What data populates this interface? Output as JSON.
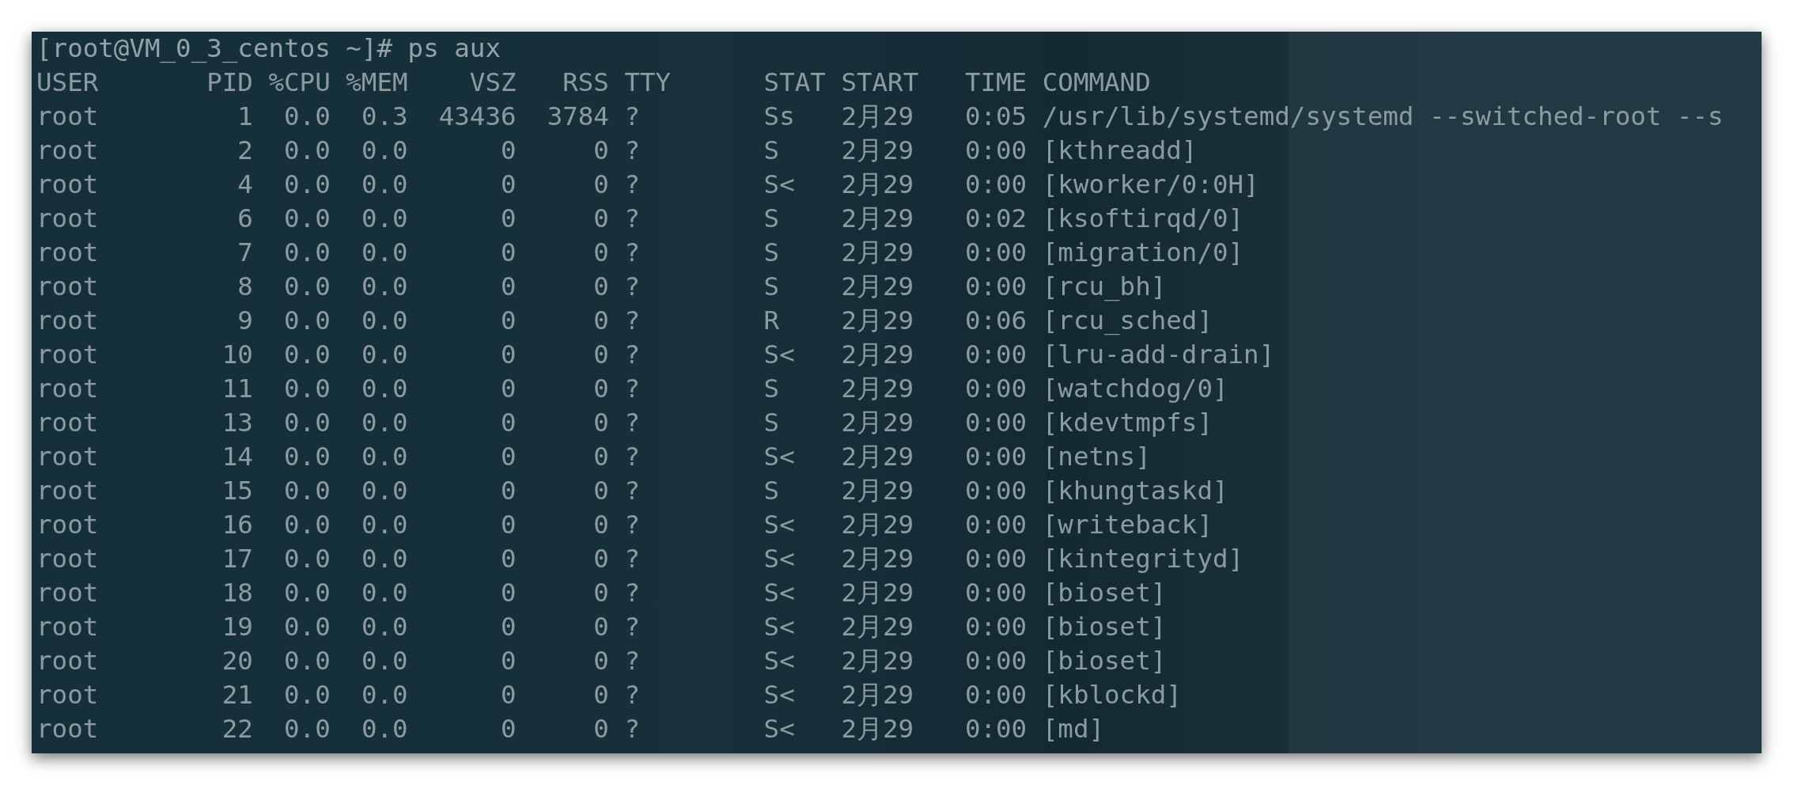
{
  "terminal": {
    "prompt": "[root@VM_0_3_centos ~]# ps aux",
    "columns": [
      "USER",
      "PID",
      "%CPU",
      "%MEM",
      "VSZ",
      "RSS",
      "TTY",
      "STAT",
      "START",
      "TIME",
      "COMMAND"
    ],
    "rows": [
      [
        "root",
        "1",
        "0.0",
        "0.3",
        "43436",
        "3784",
        "?",
        "Ss",
        "2月29",
        "0:05",
        "/usr/lib/systemd/systemd --switched-root --s"
      ],
      [
        "root",
        "2",
        "0.0",
        "0.0",
        "0",
        "0",
        "?",
        "S",
        "2月29",
        "0:00",
        "[kthreadd]"
      ],
      [
        "root",
        "4",
        "0.0",
        "0.0",
        "0",
        "0",
        "?",
        "S<",
        "2月29",
        "0:00",
        "[kworker/0:0H]"
      ],
      [
        "root",
        "6",
        "0.0",
        "0.0",
        "0",
        "0",
        "?",
        "S",
        "2月29",
        "0:02",
        "[ksoftirqd/0]"
      ],
      [
        "root",
        "7",
        "0.0",
        "0.0",
        "0",
        "0",
        "?",
        "S",
        "2月29",
        "0:00",
        "[migration/0]"
      ],
      [
        "root",
        "8",
        "0.0",
        "0.0",
        "0",
        "0",
        "?",
        "S",
        "2月29",
        "0:00",
        "[rcu_bh]"
      ],
      [
        "root",
        "9",
        "0.0",
        "0.0",
        "0",
        "0",
        "?",
        "R",
        "2月29",
        "0:06",
        "[rcu_sched]"
      ],
      [
        "root",
        "10",
        "0.0",
        "0.0",
        "0",
        "0",
        "?",
        "S<",
        "2月29",
        "0:00",
        "[lru-add-drain]"
      ],
      [
        "root",
        "11",
        "0.0",
        "0.0",
        "0",
        "0",
        "?",
        "S",
        "2月29",
        "0:00",
        "[watchdog/0]"
      ],
      [
        "root",
        "13",
        "0.0",
        "0.0",
        "0",
        "0",
        "?",
        "S",
        "2月29",
        "0:00",
        "[kdevtmpfs]"
      ],
      [
        "root",
        "14",
        "0.0",
        "0.0",
        "0",
        "0",
        "?",
        "S<",
        "2月29",
        "0:00",
        "[netns]"
      ],
      [
        "root",
        "15",
        "0.0",
        "0.0",
        "0",
        "0",
        "?",
        "S",
        "2月29",
        "0:00",
        "[khungtaskd]"
      ],
      [
        "root",
        "16",
        "0.0",
        "0.0",
        "0",
        "0",
        "?",
        "S<",
        "2月29",
        "0:00",
        "[writeback]"
      ],
      [
        "root",
        "17",
        "0.0",
        "0.0",
        "0",
        "0",
        "?",
        "S<",
        "2月29",
        "0:00",
        "[kintegrityd]"
      ],
      [
        "root",
        "18",
        "0.0",
        "0.0",
        "0",
        "0",
        "?",
        "S<",
        "2月29",
        "0:00",
        "[bioset]"
      ],
      [
        "root",
        "19",
        "0.0",
        "0.0",
        "0",
        "0",
        "?",
        "S<",
        "2月29",
        "0:00",
        "[bioset]"
      ],
      [
        "root",
        "20",
        "0.0",
        "0.0",
        "0",
        "0",
        "?",
        "S<",
        "2月29",
        "0:00",
        "[bioset]"
      ],
      [
        "root",
        "21",
        "0.0",
        "0.0",
        "0",
        "0",
        "?",
        "S<",
        "2月29",
        "0:00",
        "[kblockd]"
      ],
      [
        "root",
        "22",
        "0.0",
        "0.0",
        "0",
        "0",
        "?",
        "S<",
        "2月29",
        "0:00",
        "[md]"
      ]
    ]
  }
}
